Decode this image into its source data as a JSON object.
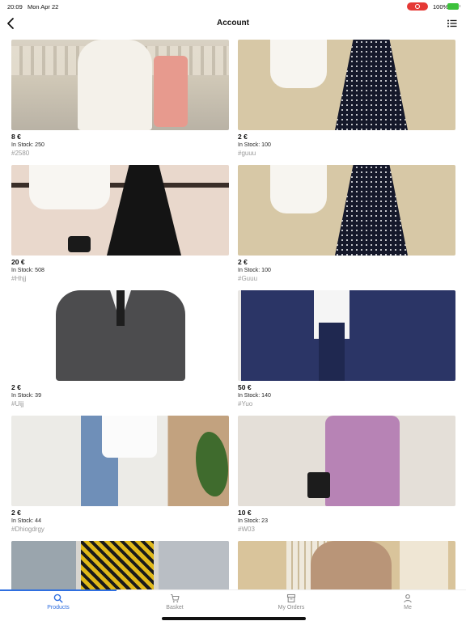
{
  "status": {
    "time": "20:09",
    "date": "Mon Apr 22",
    "battery": "100%"
  },
  "nav": {
    "title": "Account"
  },
  "products": [
    {
      "price": "8 €",
      "stock": "In Stock: 250",
      "code": "#2580"
    },
    {
      "price": "2 €",
      "stock": "In Stock: 100",
      "code": "#guuu"
    },
    {
      "price": "20 €",
      "stock": "In Stock: 508",
      "code": "#Hhjj"
    },
    {
      "price": "2 €",
      "stock": "In Stock: 100",
      "code": "#Guuu"
    },
    {
      "price": "2 €",
      "stock": "In Stock: 39",
      "code": "#Uijj"
    },
    {
      "price": "50 €",
      "stock": "In Stock: 140",
      "code": "#Yuo"
    },
    {
      "price": "2 €",
      "stock": "In Stock: 44",
      "code": "#Dhiogdrgy"
    },
    {
      "price": "10 €",
      "stock": "In Stock: 23",
      "code": "#W03"
    },
    {
      "price": "",
      "stock": "",
      "code": ""
    },
    {
      "price": "",
      "stock": "",
      "code": ""
    }
  ],
  "tabs": [
    {
      "label": "Products",
      "icon": "search-icon",
      "active": true
    },
    {
      "label": "Basket",
      "icon": "cart-icon",
      "active": false
    },
    {
      "label": "My Orders",
      "icon": "orders-icon",
      "active": false
    },
    {
      "label": "Me",
      "icon": "person-icon",
      "active": false
    }
  ],
  "colors": {
    "accent": "#2f6fe0",
    "record": "#e53935",
    "battery": "#3cc13b",
    "code_text": "#9a9a9a"
  }
}
